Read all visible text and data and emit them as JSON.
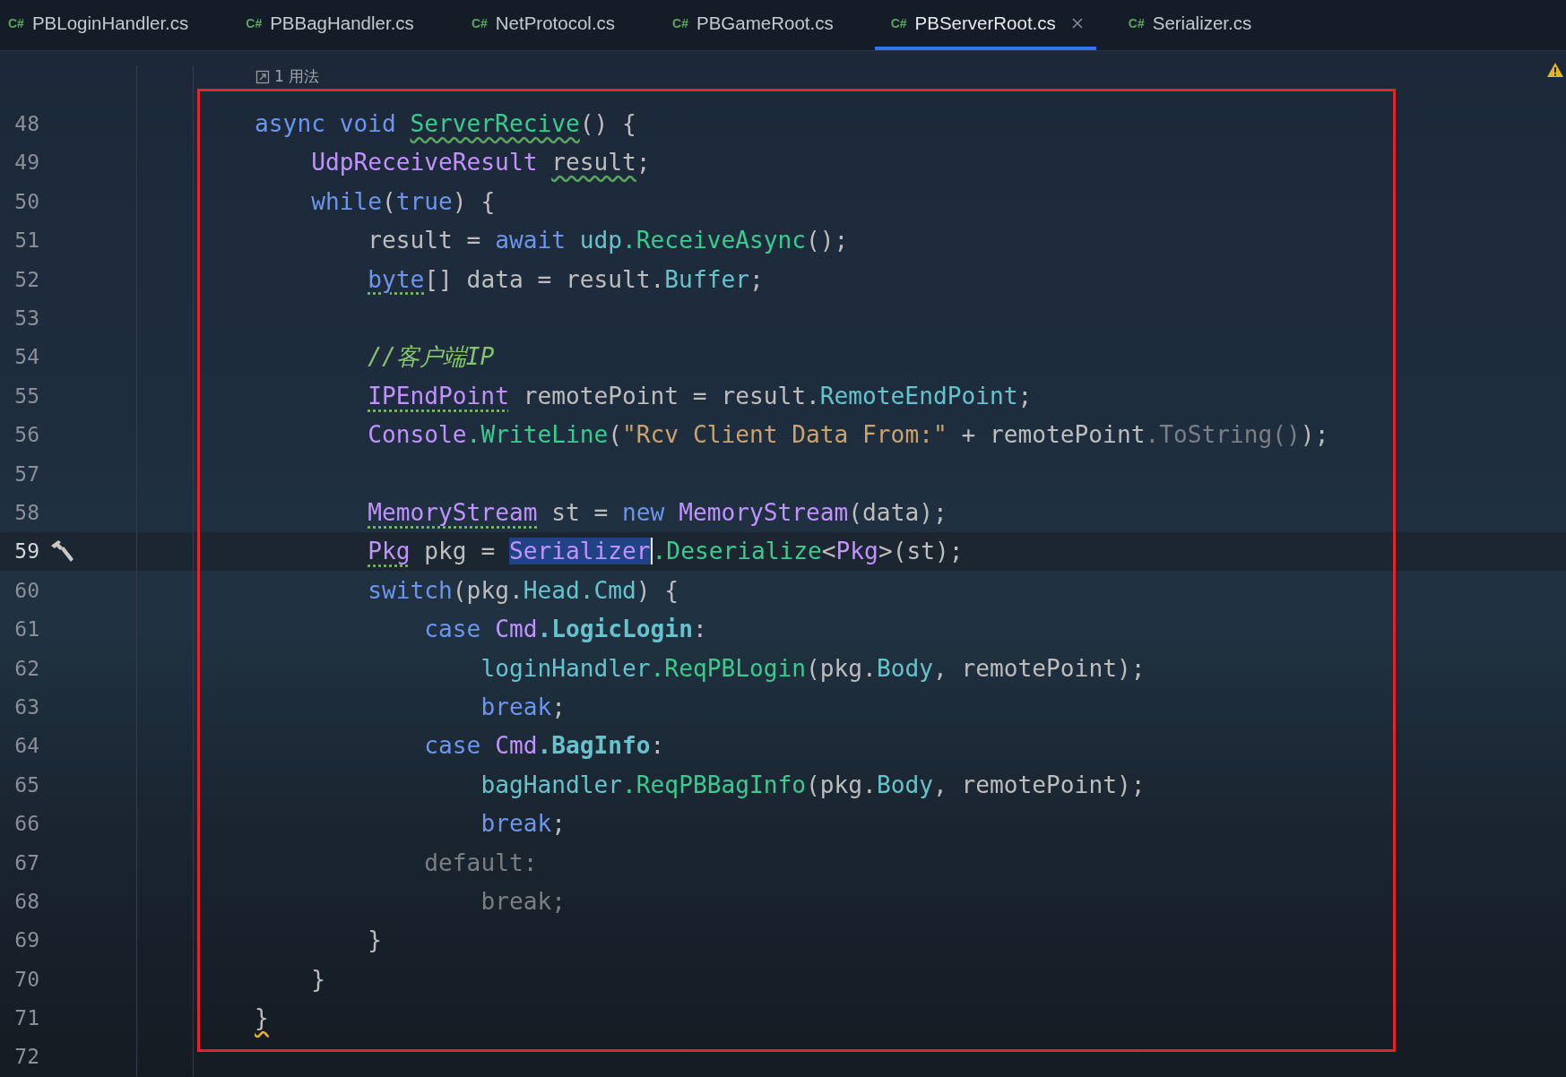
{
  "tabs": [
    {
      "lang": "C#",
      "label": "PBLoginHandler.cs",
      "selected": false,
      "closable": false
    },
    {
      "lang": "C#",
      "label": "PBBagHandler.cs",
      "selected": false,
      "closable": false
    },
    {
      "lang": "C#",
      "label": "NetProtocol.cs",
      "selected": false,
      "closable": false
    },
    {
      "lang": "C#",
      "label": "PBGameRoot.cs",
      "selected": false,
      "closable": false
    },
    {
      "lang": "C#",
      "label": "PBServerRoot.cs",
      "selected": true,
      "closable": true
    },
    {
      "lang": "C#",
      "label": "Serializer.cs",
      "selected": false,
      "closable": false
    }
  ],
  "editor": {
    "warning": true,
    "usage_hint": "1 用法",
    "lines": [
      {
        "number": "48",
        "current": false,
        "tokens": [
          {
            "kind": "keyword",
            "text": "async void "
          },
          {
            "kind": "method",
            "text": "ServerRecive",
            "misspelled": true
          },
          {
            "kind": "plain",
            "text": "() {"
          }
        ],
        "children": [
          {
            "number": "49",
            "current": false,
            "tokens": [
              {
                "kind": "type",
                "text": "UdpReceiveResult "
              },
              {
                "kind": "plain",
                "text": "result",
                "misspelled": true
              },
              {
                "kind": "plain",
                "text": ";"
              }
            ]
          },
          {
            "number": "50",
            "current": false,
            "tokens": [
              {
                "kind": "keyword",
                "text": "while"
              },
              {
                "kind": "plain",
                "text": "("
              },
              {
                "kind": "keyword",
                "text": "true"
              },
              {
                "kind": "plain",
                "text": ") {"
              }
            ],
            "children": [
              {
                "number": "51",
                "current": false,
                "tokens": [
                  {
                    "kind": "plain",
                    "text": "result = "
                  },
                  {
                    "kind": "keyword",
                    "text": "await "
                  },
                  {
                    "kind": "field",
                    "text": "udp"
                  },
                  {
                    "kind": "method",
                    "text": ".ReceiveAsync"
                  },
                  {
                    "kind": "plain",
                    "text": "();"
                  }
                ]
              },
              {
                "number": "52",
                "current": false,
                "tokens": [
                  {
                    "kind": "keyword",
                    "text": "byte",
                    "hint": true
                  },
                  {
                    "kind": "plain",
                    "text": "[] data = result."
                  },
                  {
                    "kind": "field",
                    "text": "Buffer"
                  },
                  {
                    "kind": "plain",
                    "text": ";"
                  }
                ]
              },
              {
                "number": "53",
                "current": false
              },
              {
                "number": "54",
                "current": false,
                "tokens": [
                  {
                    "kind": "comment",
                    "text": "//客户端IP"
                  }
                ]
              },
              {
                "number": "55",
                "current": false,
                "tokens": [
                  {
                    "kind": "type",
                    "text": "IPEndPoint",
                    "hint": true
                  },
                  {
                    "kind": "plain",
                    "text": " remotePoint = result."
                  },
                  {
                    "kind": "field",
                    "text": "RemoteEndPoint"
                  },
                  {
                    "kind": "plain",
                    "text": ";"
                  }
                ]
              },
              {
                "number": "56",
                "current": false,
                "tokens": [
                  {
                    "kind": "type",
                    "text": "Console"
                  },
                  {
                    "kind": "method",
                    "text": ".WriteLine"
                  },
                  {
                    "kind": "plain",
                    "text": "("
                  },
                  {
                    "kind": "string",
                    "text": "\"Rcv Client Data From:\""
                  },
                  {
                    "kind": "plain",
                    "text": " + remotePoint"
                  },
                  {
                    "kind": "muted",
                    "text": ".ToString()"
                  },
                  {
                    "kind": "plain",
                    "text": ");"
                  }
                ]
              },
              {
                "number": "57",
                "current": false
              },
              {
                "number": "58",
                "current": false,
                "tokens": [
                  {
                    "kind": "type",
                    "text": "MemoryStream",
                    "hint": true
                  },
                  {
                    "kind": "plain",
                    "text": " st = "
                  },
                  {
                    "kind": "keyword",
                    "text": "new "
                  },
                  {
                    "kind": "type",
                    "text": "MemoryStream"
                  },
                  {
                    "kind": "plain",
                    "text": "(data);"
                  }
                ]
              },
              {
                "number": "59",
                "current": true,
                "build_icon": true,
                "tokens": [
                  {
                    "kind": "type",
                    "text": "Pkg",
                    "hint": true
                  },
                  {
                    "kind": "plain",
                    "text": " pkg = "
                  },
                  {
                    "kind": "type",
                    "text": "Serializer",
                    "selected": true
                  },
                  {
                    "kind": "method",
                    "text": ".Deserialize"
                  },
                  {
                    "kind": "plain",
                    "text": "<"
                  },
                  {
                    "kind": "type",
                    "text": "Pkg"
                  },
                  {
                    "kind": "plain",
                    "text": ">(st);"
                  }
                ]
              },
              {
                "number": "60",
                "current": false,
                "tokens": [
                  {
                    "kind": "keyword",
                    "text": "switch"
                  },
                  {
                    "kind": "plain",
                    "text": "(pkg."
                  },
                  {
                    "kind": "field",
                    "text": "Head.Cmd"
                  },
                  {
                    "kind": "plain",
                    "text": ") {"
                  }
                ],
                "children": [
                  {
                    "number": "61",
                    "current": false,
                    "tokens": [
                      {
                        "kind": "keyword",
                        "text": "case "
                      },
                      {
                        "kind": "type",
                        "text": "Cmd"
                      },
                      {
                        "kind": "enum",
                        "text": ".LogicLogin"
                      },
                      {
                        "kind": "plain",
                        "text": ":"
                      }
                    ],
                    "children": [
                      {
                        "number": "62",
                        "current": false,
                        "tokens": [
                          {
                            "kind": "field",
                            "text": "loginHandler"
                          },
                          {
                            "kind": "method",
                            "text": ".ReqPBLogin"
                          },
                          {
                            "kind": "plain",
                            "text": "(pkg."
                          },
                          {
                            "kind": "field",
                            "text": "Body"
                          },
                          {
                            "kind": "plain",
                            "text": ", remotePoint);"
                          }
                        ]
                      },
                      {
                        "number": "63",
                        "current": false,
                        "tokens": [
                          {
                            "kind": "keyword",
                            "text": "break"
                          },
                          {
                            "kind": "plain",
                            "text": ";"
                          }
                        ]
                      }
                    ]
                  },
                  {
                    "number": "64",
                    "current": false,
                    "tokens": [
                      {
                        "kind": "keyword",
                        "text": "case "
                      },
                      {
                        "kind": "type",
                        "text": "Cmd"
                      },
                      {
                        "kind": "enum",
                        "text": ".BagInfo"
                      },
                      {
                        "kind": "plain",
                        "text": ":"
                      }
                    ],
                    "children": [
                      {
                        "number": "65",
                        "current": false,
                        "tokens": [
                          {
                            "kind": "field",
                            "text": "bagHandler"
                          },
                          {
                            "kind": "method",
                            "text": ".ReqPBBagInfo"
                          },
                          {
                            "kind": "plain",
                            "text": "(pkg."
                          },
                          {
                            "kind": "field",
                            "text": "Body"
                          },
                          {
                            "kind": "plain",
                            "text": ", remotePoint);"
                          }
                        ]
                      },
                      {
                        "number": "66",
                        "current": false,
                        "tokens": [
                          {
                            "kind": "keyword",
                            "text": "break"
                          },
                          {
                            "kind": "plain",
                            "text": ";"
                          }
                        ]
                      }
                    ]
                  },
                  {
                    "number": "67",
                    "current": false,
                    "tokens": [
                      {
                        "kind": "muted",
                        "text": "default:"
                      }
                    ],
                    "children": [
                      {
                        "number": "68",
                        "current": false,
                        "tokens": [
                          {
                            "kind": "muted",
                            "text": "break;"
                          }
                        ]
                      }
                    ]
                  }
                ]
              },
              {
                "number": "69",
                "current": false,
                "tokens": [
                  {
                    "kind": "plain",
                    "text": "}"
                  }
                ]
              }
            ]
          },
          {
            "number": "70",
            "current": false,
            "tokens": [
              {
                "kind": "plain",
                "text": "}"
              }
            ]
          }
        ]
      },
      {
        "number": "71",
        "current": false,
        "tokens": [
          {
            "kind": "plain",
            "text": "}",
            "warning": true
          }
        ]
      },
      {
        "number": "72",
        "current": false
      }
    ]
  },
  "annotation": {
    "frame": true
  }
}
